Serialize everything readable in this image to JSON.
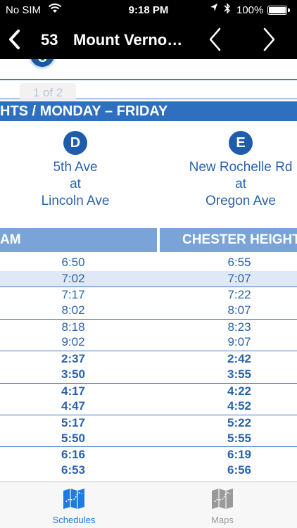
{
  "status_bar": {
    "carrier": "No SIM",
    "time": "9:18 PM",
    "battery": "100%"
  },
  "nav": {
    "route_number": "53",
    "title": "Mount Verno…"
  },
  "page_indicator": "1 of 2",
  "partial_stop_letter": "C",
  "schedule_heading": "HTS  / MONDAY – FRIDAY",
  "stops": [
    {
      "letter": "D",
      "line1": "5th Ave",
      "line2": "at",
      "line3": "Lincoln Ave"
    },
    {
      "letter": "E",
      "line1": "New Rochelle Rd",
      "line2": "at",
      "line3": "Oregon Ave"
    }
  ],
  "columns": {
    "left": "AM",
    "right": "CHESTER HEIGHTS"
  },
  "rows": [
    {
      "d": "6:50",
      "e": "6:55"
    },
    {
      "d": "7:02",
      "e": "7:07"
    },
    {
      "d": "7:17",
      "e": "7:22"
    },
    {
      "d": "8:02",
      "e": "8:07"
    },
    {
      "d": "8:18",
      "e": "8:23"
    },
    {
      "d": "9:02",
      "e": "9:07"
    },
    {
      "d": "2:37",
      "e": "2:42"
    },
    {
      "d": "3:50",
      "e": "3:55"
    },
    {
      "d": "4:17",
      "e": "4:22"
    },
    {
      "d": "4:47",
      "e": "4:52"
    },
    {
      "d": "5:17",
      "e": "5:22"
    },
    {
      "d": "5:50",
      "e": "5:55"
    },
    {
      "d": "6:16",
      "e": "6:19"
    },
    {
      "d": "6:53",
      "e": "6:56"
    }
  ],
  "tabs": [
    {
      "label": "Schedules",
      "selected": true,
      "icon": "map-icon"
    },
    {
      "label": "Maps",
      "selected": false,
      "icon": "map-icon"
    }
  ],
  "colors": {
    "accent_blue": "#2f6fc0",
    "time_text": "#2a63ad",
    "tab_active": "#1e7be0"
  }
}
